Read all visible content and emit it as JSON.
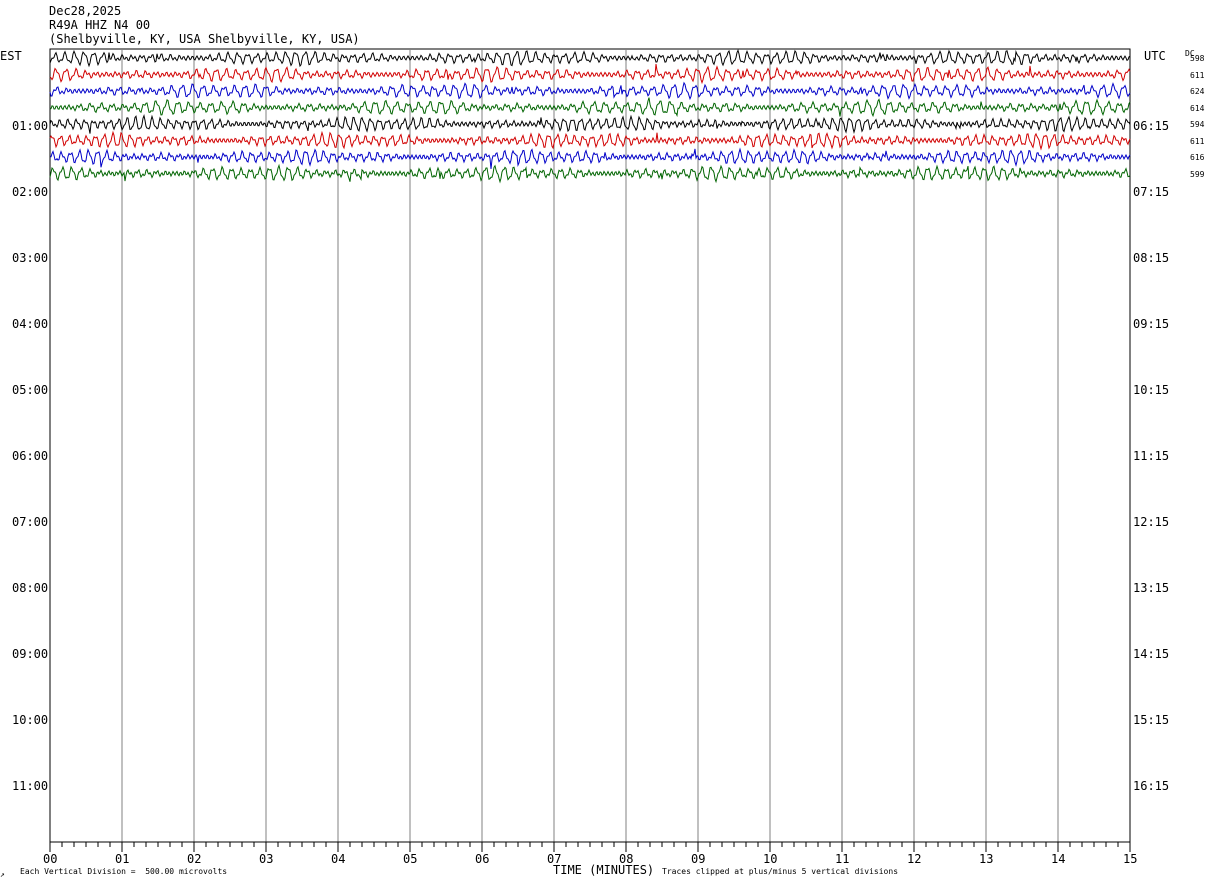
{
  "header": {
    "date": "Dec28,2025",
    "station": "R49A HHZ N4 00",
    "location": "(Shelbyville, KY, USA Shelbyville, KY, USA)"
  },
  "axes": {
    "left_label": "EST",
    "right_label": "UTC",
    "dc_label": "DC",
    "xlabel": "TIME (MINUTES)",
    "scale_note": "Each Vertical Division =  500.00 microvolts",
    "clip_note": "Traces clipped at plus/minus 5 vertical divisions"
  },
  "colors": {
    "trace_cycle": [
      "#000000",
      "#d10000",
      "#0000c8",
      "#006400"
    ],
    "grid": "#808080"
  },
  "chart_data": {
    "type": "line",
    "title": "R49A HHZ N4 00",
    "xlabel": "TIME (MINUTES)",
    "xlim": [
      0,
      15
    ],
    "x_ticks": [
      "00",
      "01",
      "02",
      "03",
      "04",
      "05",
      "06",
      "07",
      "08",
      "09",
      "10",
      "11",
      "12",
      "13",
      "14",
      "15"
    ],
    "est_hours": [
      "01:00",
      "02:00",
      "03:00",
      "04:00",
      "05:00",
      "06:00",
      "07:00",
      "08:00",
      "09:00",
      "10:00",
      "11:00"
    ],
    "utc_hours": [
      "06:15",
      "07:15",
      "08:15",
      "09:15",
      "10:15",
      "11:15",
      "12:15",
      "13:15",
      "14:15",
      "15:15",
      "16:15"
    ],
    "row_minutes": 15,
    "rows_recorded": 8,
    "dc_offsets": [
      "598",
      "611",
      "624",
      "614",
      "594",
      "611",
      "616",
      "599"
    ],
    "series": [
      {
        "start_est": "00:00"
      },
      {
        "start_est": "00:15"
      },
      {
        "start_est": "00:30"
      },
      {
        "start_est": "00:45"
      },
      {
        "start_est": "01:00"
      },
      {
        "start_est": "01:15"
      },
      {
        "start_est": "01:30"
      },
      {
        "start_est": "01:45"
      }
    ]
  }
}
